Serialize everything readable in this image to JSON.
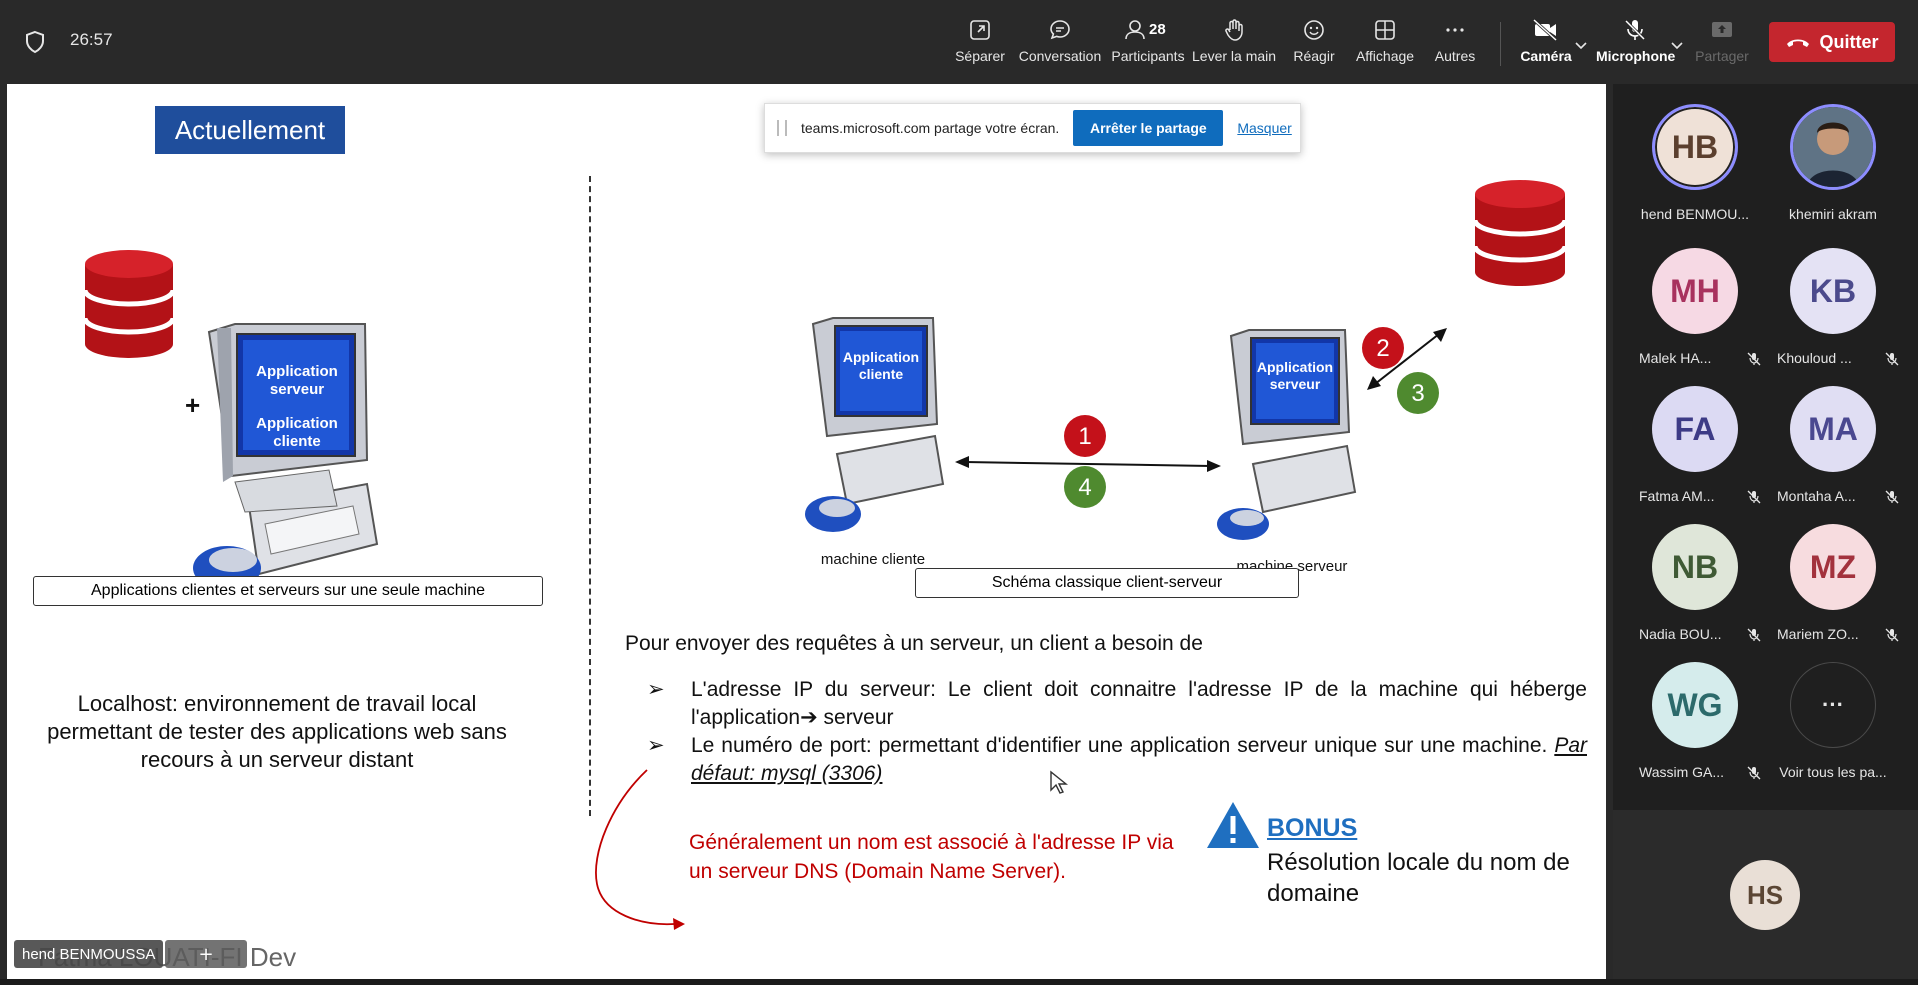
{
  "meeting": {
    "timer": "26:57"
  },
  "toolbar": {
    "items": [
      {
        "label": "Séparer",
        "icon": "pop-out-icon"
      },
      {
        "label": "Conversation",
        "icon": "chat-icon"
      },
      {
        "label": "Participants",
        "icon": "people-icon",
        "count": "28"
      },
      {
        "label": "Lever la main",
        "icon": "raise-hand-icon"
      },
      {
        "label": "Réagir",
        "icon": "smiley-icon"
      },
      {
        "label": "Affichage",
        "icon": "grid-view-icon"
      },
      {
        "label": "Autres",
        "icon": "more-icon"
      },
      {
        "label": "Caméra",
        "icon": "camera-off-icon"
      },
      {
        "label": "Microphone",
        "icon": "mic-off-icon"
      },
      {
        "label": "Partager",
        "icon": "share-icon"
      }
    ],
    "quit_label": "Quitter"
  },
  "share_banner": {
    "text": "teams.microsoft.com partage votre écran.",
    "stop_label": "Arrêter le partage",
    "hide_label": "Masquer"
  },
  "slide": {
    "title": "Actuellement",
    "left_monitor_top": "Application serveur",
    "left_monitor_bottom": "Application cliente",
    "plus": "+",
    "left_caption": "Applications clientes et serveurs sur une seule machine",
    "localhost_text": "Localhost: environnement de travail local permettant de tester des applications web sans recours à un serveur distant",
    "client_monitor": "Application cliente",
    "server_monitor": "Application serveur",
    "client_label": "machine cliente",
    "server_label": "machine serveur",
    "steps": [
      "1",
      "2",
      "3",
      "4"
    ],
    "right_caption": "Schéma classique client-serveur",
    "intro": "Pour envoyer des requêtes à un serveur, un client a besoin de",
    "bullet1": "L'adresse IP du serveur: Le client doit connaitre l'adresse IP de la machine qui héberge l'application➔ serveur",
    "bullet2_main": "Le numéro de port: permettant d'identifier une application serveur unique sur une machine.",
    "bullet2_default": "Par défaut: mysql (3306)",
    "bullet_marker": "➢",
    "note": "Généralement un nom est associé à l'adresse IP via un serveur DNS (Domain Name Server).",
    "bonus_title": "BONUS",
    "bonus_text": "Résolution locale du nom de domaine",
    "colors": {
      "title_bg": "#1f4e9c",
      "db_red": "#b31217",
      "step_red": "#c4111a",
      "step_green": "#4f8a2f",
      "note_red": "#c00000",
      "bonus_blue": "#1f6fc0"
    }
  },
  "overlay": {
    "ghost_name": "Fatma LOUATI-FI Dev",
    "presenter": "hend BENMOUSSA",
    "plus": "+"
  },
  "participants": [
    {
      "initials": "HB",
      "name": "hend BENMOU...",
      "muted": false,
      "ring": true,
      "bg": "#efe1d7",
      "fg": "#5b3f2e"
    },
    {
      "initials": "",
      "name": "khemiri akram",
      "muted": false,
      "ring": true,
      "photo": true
    },
    {
      "initials": "MH",
      "name": "Malek HA...",
      "muted": true,
      "bg": "#f6d9e4",
      "fg": "#a8325e"
    },
    {
      "initials": "KB",
      "name": "Khouloud ...",
      "muted": true,
      "bg": "#e4e2f4",
      "fg": "#4b4a8c"
    },
    {
      "initials": "FA",
      "name": "Fatma AM...",
      "muted": true,
      "bg": "#dcdaf3",
      "fg": "#3d3b86"
    },
    {
      "initials": "MA",
      "name": "Montaha A...",
      "muted": true,
      "bg": "#e0def3",
      "fg": "#4a4890"
    },
    {
      "initials": "NB",
      "name": "Nadia BOU...",
      "muted": true,
      "bg": "#dfe6d9",
      "fg": "#3f5a35"
    },
    {
      "initials": "MZ",
      "name": "Mariem ZO...",
      "muted": true,
      "bg": "#f7dcdf",
      "fg": "#a3323d"
    },
    {
      "initials": "WG",
      "name": "Wassim GA...",
      "muted": true,
      "bg": "#d5ecec",
      "fg": "#2c6a6b"
    },
    {
      "initials": "···",
      "name": "Voir tous les pa...",
      "muted": false,
      "more": true
    }
  ],
  "self_view": {
    "initials": "HS"
  }
}
